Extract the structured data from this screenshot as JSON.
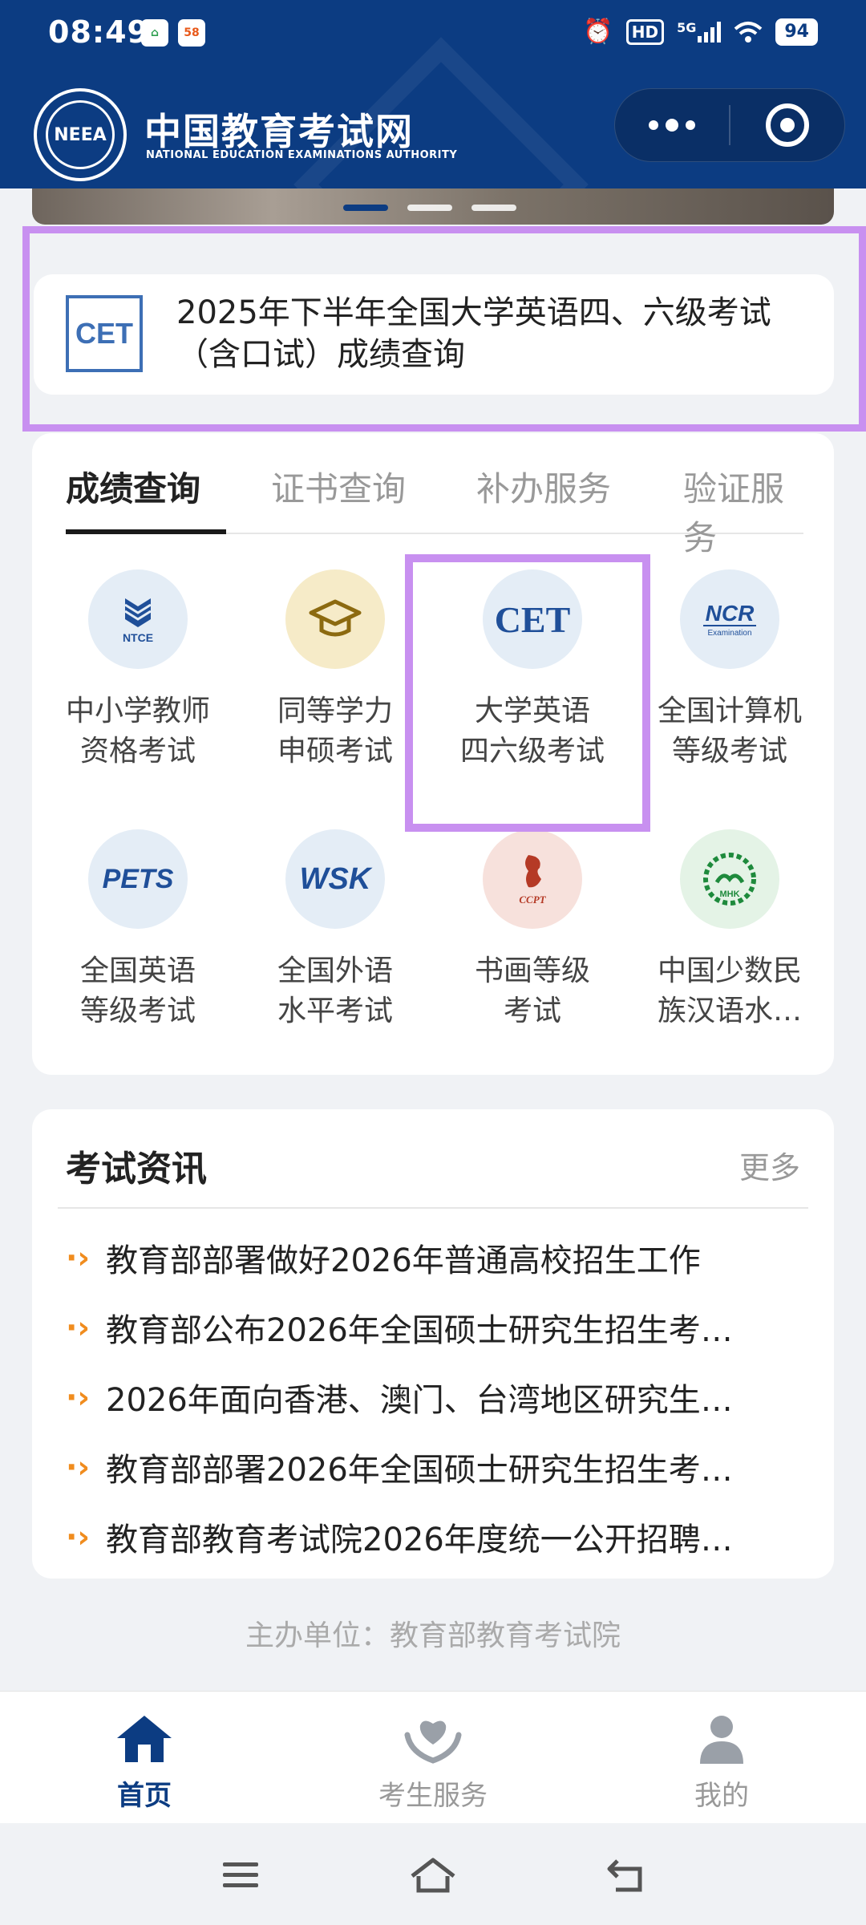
{
  "status_bar": {
    "time": "08:49",
    "left_icons": [
      "app-notification-icon",
      "58-app-icon"
    ],
    "badge_58": "58",
    "hd": "HD",
    "network": "5G",
    "battery": "94"
  },
  "header": {
    "logo_text": "NEEA",
    "title": "中国教育考试网",
    "subtitle": "NATIONAL EDUCATION EXAMINATIONS AUTHORITY",
    "bg_color": "#0c3c82"
  },
  "banner": {
    "pages": 3,
    "active_index": 0
  },
  "notice": {
    "badge": "CET",
    "text": "2025年下半年全国大学英语四、六级考试（含口试）成绩查询"
  },
  "tabs": [
    {
      "label": "成绩查询",
      "active": true
    },
    {
      "label": "证书查询",
      "active": false
    },
    {
      "label": "补办服务",
      "active": false
    },
    {
      "label": "验证服务",
      "active": false
    }
  ],
  "services": [
    {
      "icon": "ntce-icon",
      "icon_text": "NTCE",
      "line1": "中小学教师",
      "line2": "资格考试"
    },
    {
      "icon": "graduation-cap-icon",
      "icon_text": "",
      "line1": "同等学力",
      "line2": "申硕考试"
    },
    {
      "icon": "cet-icon",
      "icon_text": "CET",
      "line1": "大学英语",
      "line2": "四六级考试"
    },
    {
      "icon": "ncre-icon",
      "icon_text": "NCRE",
      "line1": "全国计算机",
      "line2": "等级考试"
    },
    {
      "icon": "pets-icon",
      "icon_text": "PETS",
      "line1": "全国英语",
      "line2": "等级考试"
    },
    {
      "icon": "wsk-icon",
      "icon_text": "WSK",
      "line1": "全国外语",
      "line2": "水平考试"
    },
    {
      "icon": "ccpt-icon",
      "icon_text": "CCPT",
      "line1": "书画等级",
      "line2": "考试"
    },
    {
      "icon": "mhk-icon",
      "icon_text": "MHK",
      "line1": "中国少数民",
      "line2": "族汉语水…"
    }
  ],
  "news": {
    "title": "考试资讯",
    "more": "更多",
    "items": [
      "教育部部署做好2026年普通高校招生工作",
      "教育部公布2026年全国硕士研究生招生考…",
      "2026年面向香港、澳门、台湾地区研究生…",
      "教育部部署2026年全国硕士研究生招生考…",
      "教育部教育考试院2026年度统一公开招聘…"
    ]
  },
  "footer": {
    "host": "主办单位：教育部教育考试院"
  },
  "tabbar": [
    {
      "icon": "home-icon",
      "label": "首页",
      "active": true
    },
    {
      "icon": "heart-hand-icon",
      "label": "考生服务",
      "active": false
    },
    {
      "icon": "user-icon",
      "label": "我的",
      "active": false
    }
  ],
  "colors": {
    "primary": "#0c3c82",
    "highlight": "#c890f0",
    "news_arrow": "#f08c1e"
  }
}
